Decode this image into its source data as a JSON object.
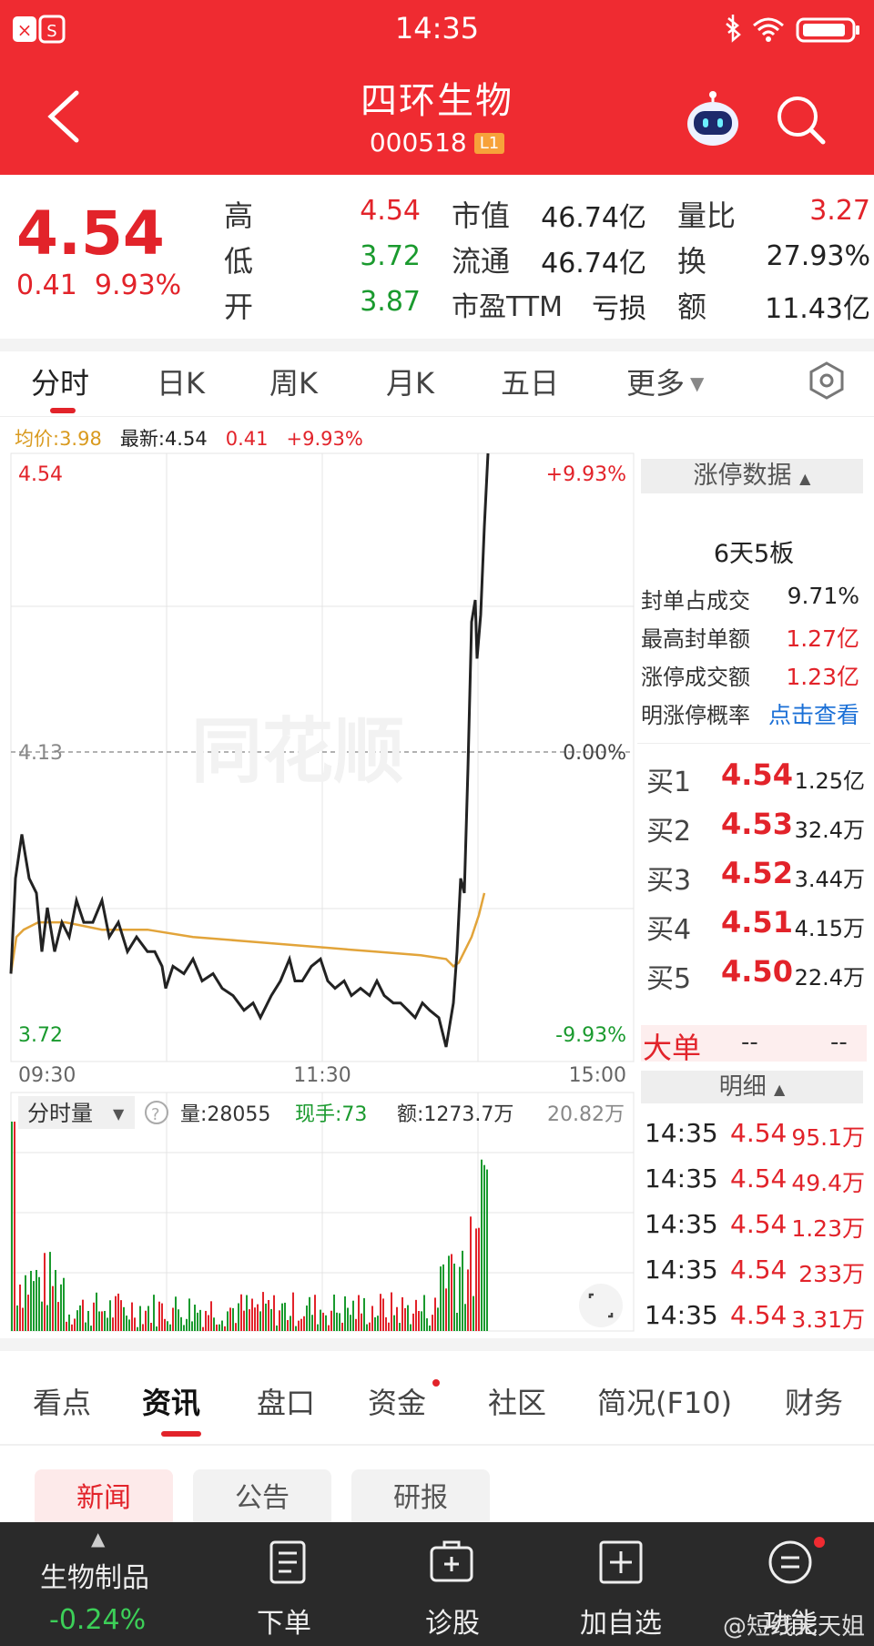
{
  "status": {
    "time": "14:35"
  },
  "header": {
    "title": "四环生物",
    "code": "000518",
    "tag": "L1"
  },
  "quote": {
    "price": "4.54",
    "change": "0.41",
    "change_pct": "9.93%",
    "col1": [
      {
        "label": "高",
        "value": "4.54"
      },
      {
        "label": "低",
        "value": "3.72"
      },
      {
        "label": "开",
        "value": "3.87"
      }
    ],
    "col2": [
      {
        "label": "市值",
        "value": "46.74亿"
      },
      {
        "label": "流通",
        "value": "46.74亿"
      },
      {
        "label": "市盈TTM",
        "value": "亏损"
      }
    ],
    "col3": [
      {
        "label": "量比",
        "value": "3.27"
      },
      {
        "label": "换",
        "value": "27.93%"
      },
      {
        "label": "额",
        "value": "11.43亿"
      }
    ]
  },
  "tabs": [
    "分时",
    "日K",
    "周K",
    "月K",
    "五日",
    "更多"
  ],
  "avg_line": {
    "avg": "均价:3.98",
    "latest": "最新:4.54",
    "chg": "0.41",
    "pct": "+9.93%"
  },
  "chart_labels": {
    "high": "4.54",
    "mid": "4.13",
    "low": "3.72",
    "up_pct": "+9.93%",
    "zero_pct": "0.00%",
    "down_pct": "-9.93%",
    "t_start": "09:30",
    "t_mid": "11:30",
    "t_end": "15:00",
    "watermark": "同花顺"
  },
  "volume_bar": {
    "selector": "分时量",
    "vol": "量:28055",
    "hand": "现手:73",
    "amount": "额:1273.7万",
    "max": "20.82万"
  },
  "colors": {
    "up": "#e2232a",
    "down": "#1a9a2e",
    "price_line": "#222222",
    "avg_line": "#e2a43a"
  },
  "limit_panel": {
    "header": "涨停数据",
    "streak": "6天5板",
    "rows": [
      {
        "label": "封单占成交",
        "value": "9.71%"
      },
      {
        "label": "最高封单额",
        "value": "1.27亿"
      },
      {
        "label": "涨停成交额",
        "value": "1.23亿"
      },
      {
        "label": "明涨停概率",
        "value": "点击查看"
      }
    ]
  },
  "bids": [
    {
      "label": "买1",
      "price": "4.54",
      "vol": "1.25亿"
    },
    {
      "label": "买2",
      "price": "4.53",
      "vol": "32.4万"
    },
    {
      "label": "买3",
      "price": "4.52",
      "vol": "3.44万"
    },
    {
      "label": "买4",
      "price": "4.51",
      "vol": "4.15万"
    },
    {
      "label": "买5",
      "price": "4.50",
      "vol": "22.4万"
    }
  ],
  "big_order": {
    "label": "大单",
    "v1": "--",
    "v2": "--"
  },
  "detail": {
    "header": "明细",
    "rows": [
      {
        "time": "14:35",
        "price": "4.54",
        "vol": "95.1万"
      },
      {
        "time": "14:35",
        "price": "4.54",
        "vol": "49.4万"
      },
      {
        "time": "14:35",
        "price": "4.54",
        "vol": "1.23万"
      },
      {
        "time": "14:35",
        "price": "4.54",
        "vol": "233万"
      },
      {
        "time": "14:35",
        "price": "4.54",
        "vol": "3.31万"
      }
    ]
  },
  "info_tabs": [
    "看点",
    "资讯",
    "盘口",
    "资金",
    "社区",
    "简况(F10)",
    "财务"
  ],
  "news_pills": [
    "新闻",
    "公告",
    "研报"
  ],
  "bottom": {
    "sector": "生物制品",
    "sector_pct": "-0.24%",
    "buttons": [
      "下单",
      "诊股",
      "加自选",
      "功能"
    ],
    "watermark": "@短线天天姐"
  }
}
